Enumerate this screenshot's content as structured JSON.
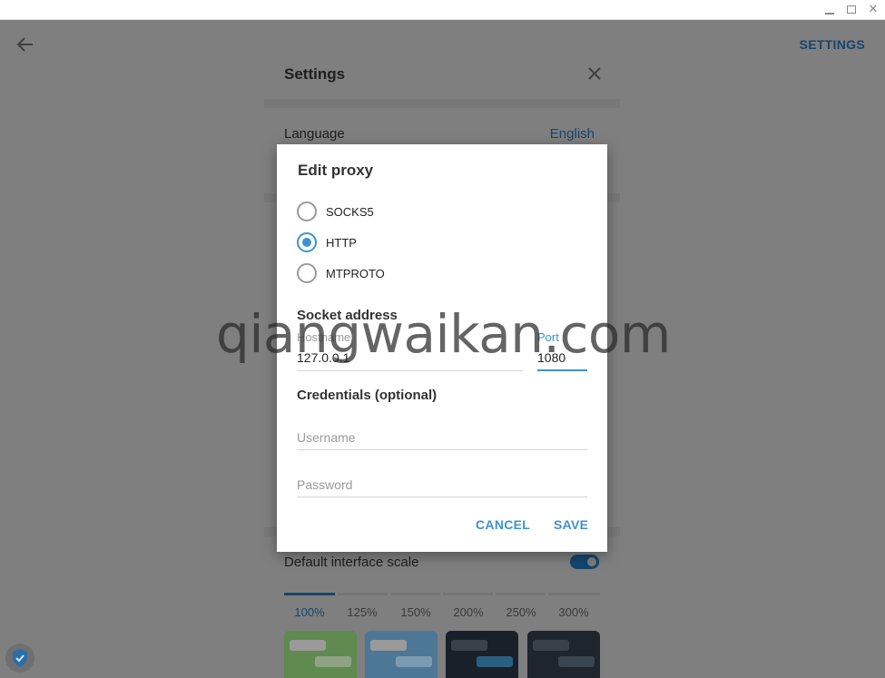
{
  "window": {
    "controls": [
      "minimize",
      "maximize",
      "close"
    ],
    "close_glyph": "✕"
  },
  "header": {
    "back_icon": "arrow-left-icon",
    "settings_link": "SETTINGS"
  },
  "settings_panel": {
    "title": "Settings",
    "language_label": "Language",
    "language_value": "English",
    "interface_scale_label": "Default interface scale",
    "interface_scale_enabled": true,
    "scale_options": [
      "100%",
      "125%",
      "150%",
      "200%",
      "250%",
      "300%"
    ],
    "selected_scale": "100%"
  },
  "dialog": {
    "title": "Edit proxy",
    "proxy_types": [
      {
        "label": "SOCKS5",
        "checked": false
      },
      {
        "label": "HTTP",
        "checked": true
      },
      {
        "label": "MTPROTO",
        "checked": false
      }
    ],
    "socket_section": "Socket address",
    "hostname_label": "Hostname",
    "hostname_value": "127.0.0.1",
    "port_label": "Port",
    "port_value": "1080",
    "credentials_section": "Credentials (optional)",
    "username_placeholder": "Username",
    "password_placeholder": "Password",
    "cancel_label": "CANCEL",
    "save_label": "SAVE"
  },
  "watermark": "qiangwaikan.com",
  "colors": {
    "accent": "#3c93cf",
    "overlay": "#7f7f7f",
    "link_dimmed": "#14466e"
  }
}
